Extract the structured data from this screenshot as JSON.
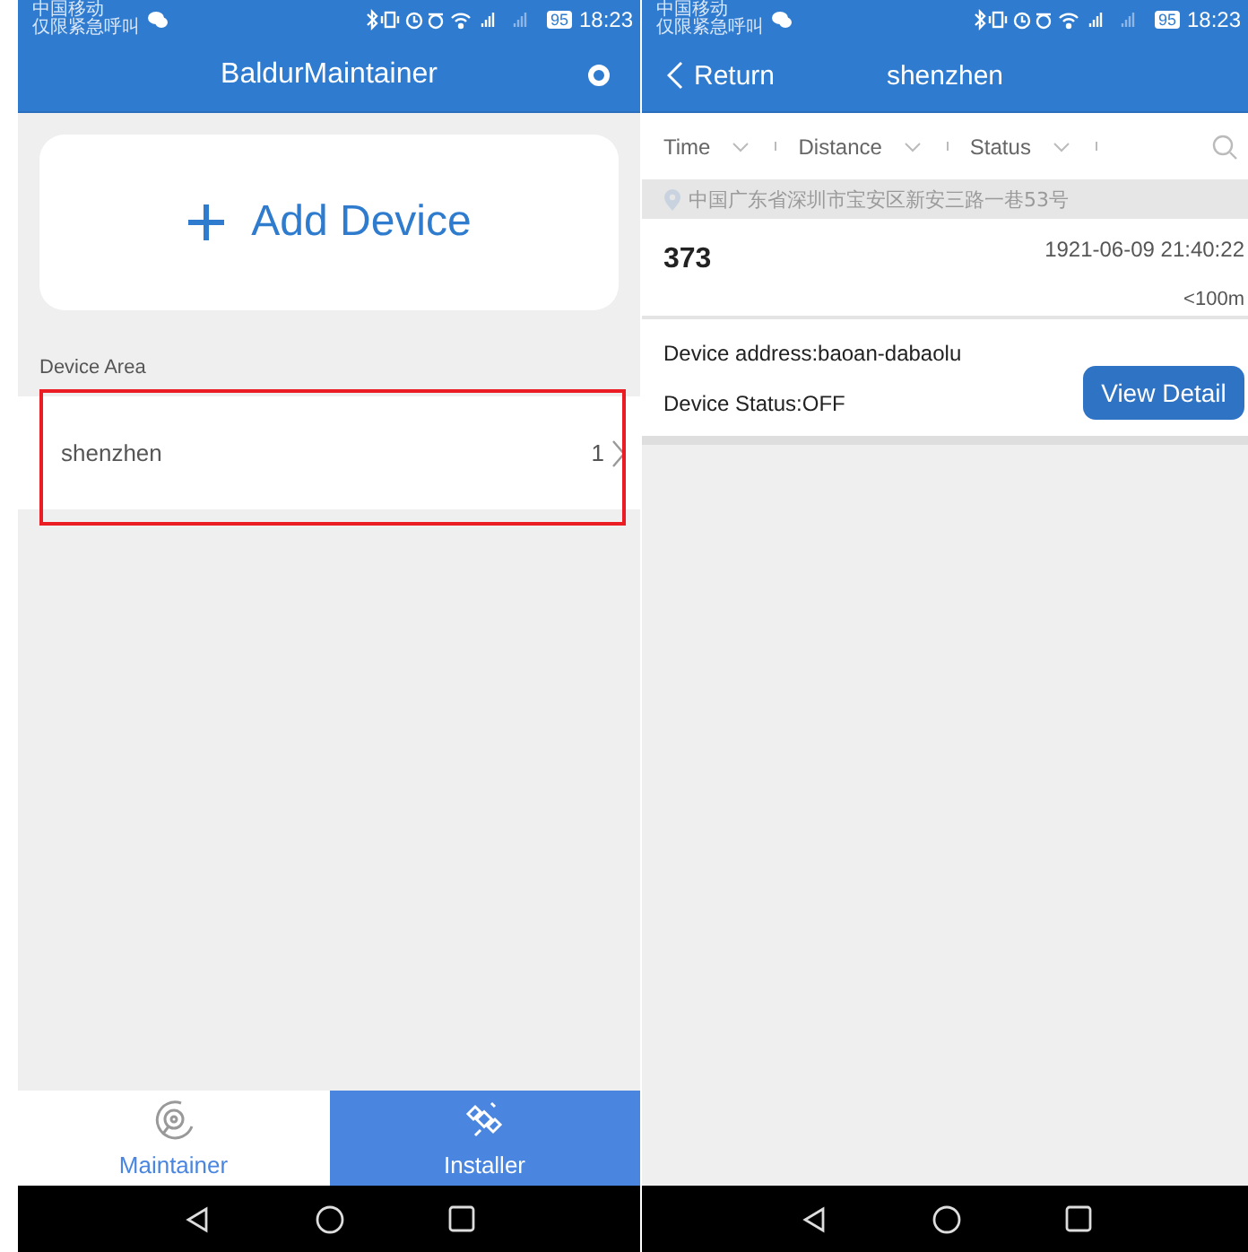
{
  "screens": [
    {
      "kind": "list",
      "status_bar": {
        "carrier": "中国移动",
        "carrier_note": "仅限紧急呼叫",
        "battery": "95",
        "time": "18:23"
      },
      "header": {
        "title": "BaldurMaintainer"
      },
      "add_button": {
        "label": "Add Device"
      },
      "section_label": "Device Area",
      "areas": [
        {
          "name": "shenzhen",
          "count": "1",
          "highlighted": true
        }
      ],
      "tabs": [
        {
          "label": "Maintainer",
          "selected": false
        },
        {
          "label": "Installer",
          "selected": true
        }
      ]
    },
    {
      "kind": "detail",
      "status_bar": {
        "carrier": "中国移动",
        "carrier_note": "仅限紧急呼叫",
        "battery": "95",
        "time": "18:23"
      },
      "header": {
        "back": "Return",
        "title": "shenzhen"
      },
      "filters": [
        {
          "label": "Time"
        },
        {
          "label": "Distance"
        },
        {
          "label": "Status"
        }
      ],
      "location": "中国广东省深圳市宝安区新安三路一巷53号",
      "devices": [
        {
          "id": "373",
          "time": "1921-06-09 21:40:22",
          "distance": "<100m",
          "address": "Device address:baoan-dabaolu",
          "status": "Device Status:OFF",
          "button": "View Detail"
        }
      ]
    }
  ]
}
